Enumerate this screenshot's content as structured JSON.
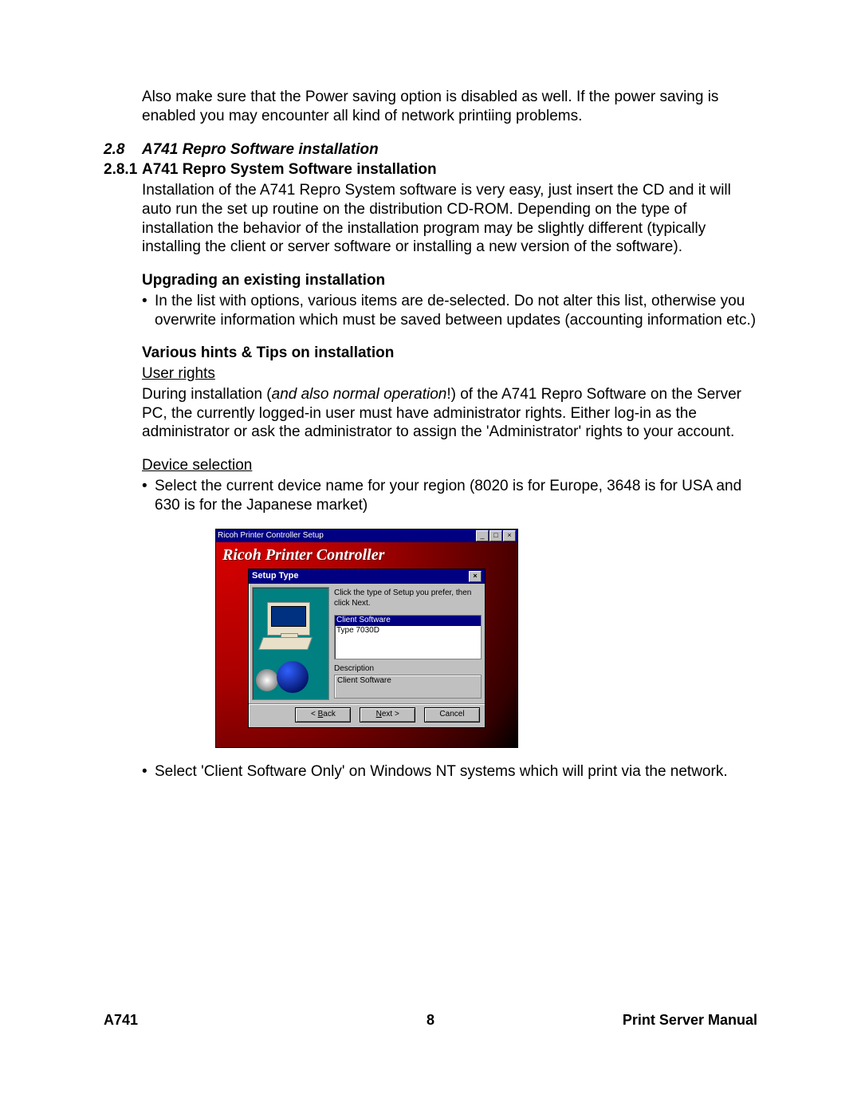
{
  "intro_para": "Also make sure that the Power saving option is disabled as well. If the power saving is enabled you may encounter all kind of network printiing problems.",
  "section": {
    "num": "2.8",
    "title": "A741 Repro Software installation"
  },
  "subsection": {
    "num": "2.8.1",
    "title": "A741 Repro System Software installation"
  },
  "install_para": "Installation of the A741 Repro System software is very easy, just insert the CD and it will auto run the set up routine on the distribution CD-ROM. Depending on the type of installation the behavior of the installation program may be slightly different (typically installing the client or server software or installing a new version of the software).",
  "upgrade_head": "Upgrading an existing installation",
  "upgrade_bullet": "In the list with options, various items are de-selected. Do not alter this list, otherwise you overwrite information which must be saved between updates (accounting information etc.)",
  "hints_head": "Various hints & Tips on installation",
  "user_rights_label": "User rights",
  "user_rights_pre": "During installation (",
  "user_rights_italic": "and also normal operation",
  "user_rights_post": "!) of the A741 Repro Software on the Server PC, the currently logged-in user must have administrator rights. Either log-in as the administrator or ask the administrator to assign the 'Administrator' rights to your account.",
  "device_sel_label": "Device selection",
  "device_bullet": "Select the current device name for your region (8020 is for Europe, 3648 is for USA and 630 is for the Japanese market)",
  "post_shot_bullet": "Select 'Client Software Only' on Windows NT systems which will print via the network.",
  "screenshot": {
    "outer_title": "Ricoh Printer Controller Setup",
    "app_title": "Ricoh Printer Controller",
    "dialog_title": "Setup Type",
    "instruction": "Click the type of Setup you prefer, then click Next.",
    "list_selected": "Client Software",
    "list_item2": "Type 7030D",
    "desc_label": "Description",
    "desc_text": "Client Software",
    "btn_back": "Back",
    "btn_next": "Next >",
    "btn_cancel": "Cancel",
    "btn_min": "_",
    "btn_max": "□",
    "btn_close": "×"
  },
  "footer": {
    "left": "A741",
    "center": "8",
    "right": "Print Server Manual"
  }
}
